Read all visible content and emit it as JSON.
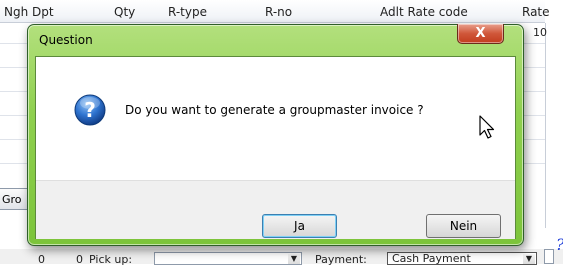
{
  "background": {
    "columns": [
      "Ngh Dpt",
      "Qty",
      "R-type",
      "R-no",
      "Adlt Rate code",
      "Rate"
    ],
    "first_row_value": "10",
    "group_button_label": "Gro",
    "bottom_bar": {
      "num1": "0",
      "num2": "0",
      "pickup_label": "Pick up:",
      "payment_label": "Payment:",
      "payment_value": "Cash Payment"
    },
    "stray_text": "?‘"
  },
  "dialog": {
    "title": "Question",
    "close_label": "X",
    "message": "Do you want to generate a groupmaster invoice ?",
    "icon": "question-icon",
    "buttons": {
      "yes_label": "Ja",
      "no_label": "Nein"
    }
  },
  "colors": {
    "frame_green": "#8fd04f",
    "close_red": "#c23c1e",
    "icon_blue": "#1e63c8"
  }
}
